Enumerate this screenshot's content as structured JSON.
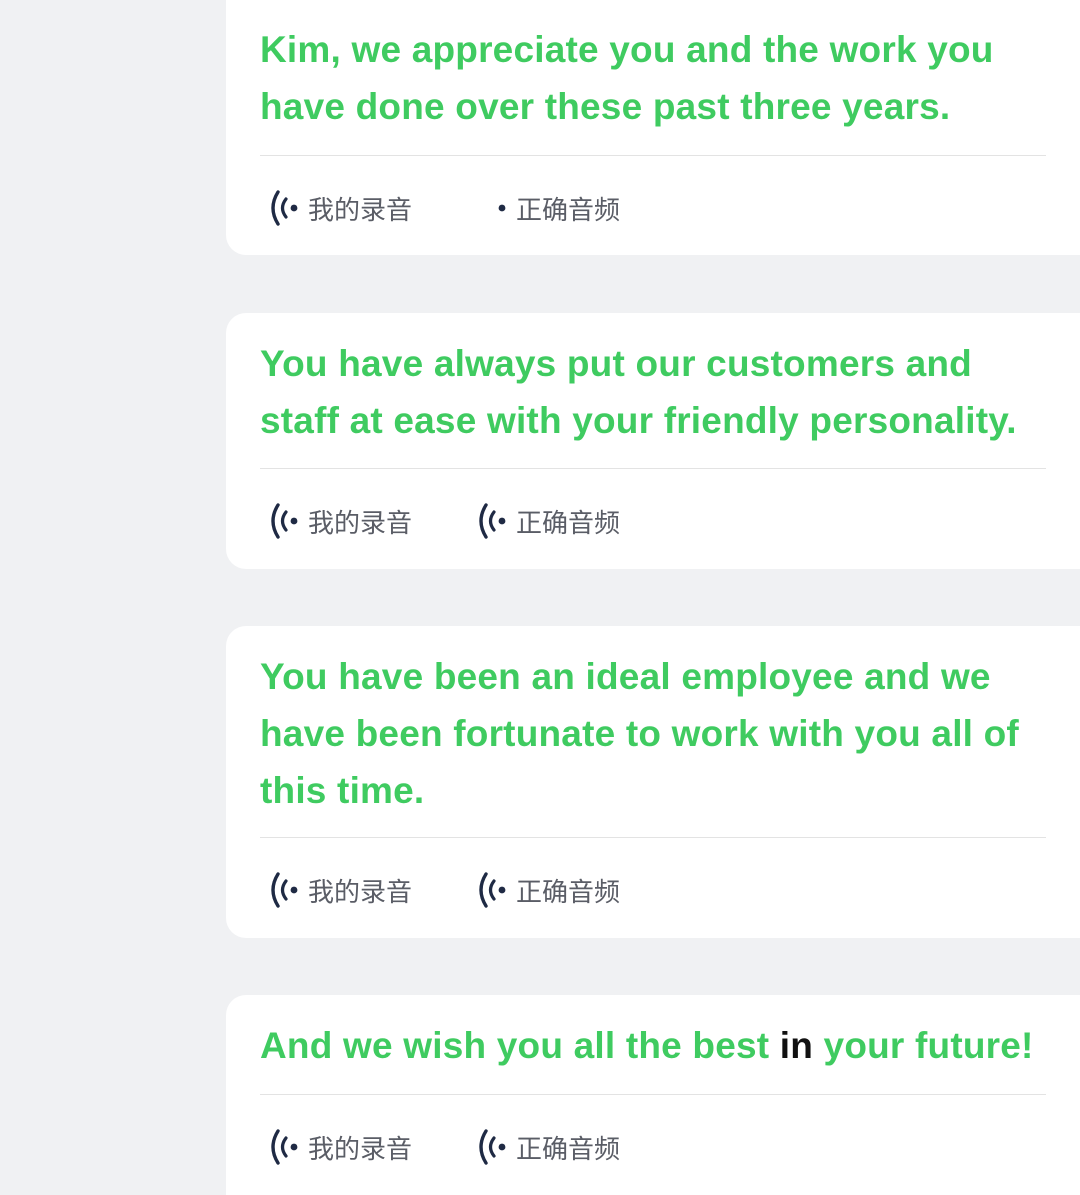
{
  "colors": {
    "correct_text": "#3fcb60",
    "wrong_text": "#111111",
    "label_text": "#5a5d66",
    "icon": "#1f2a44",
    "card_bg": "#ffffff",
    "page_bg": "#f0f1f3"
  },
  "cards": [
    {
      "lines": [
        "Kim, we appreciate you and the work you",
        "have done over these past three years."
      ],
      "my_recording_label": "我的录音",
      "correct_audio_label": "正确音频",
      "correct_audio_icon": "dot-icon"
    },
    {
      "lines": [
        "You have always put our customers and",
        "staff at ease with your friendly personality."
      ],
      "my_recording_label": "我的录音",
      "correct_audio_label": "正确音频",
      "correct_audio_icon": "sound-wave-icon"
    },
    {
      "lines": [
        "You have been an ideal employee and we",
        "have been fortunate to work with you all of",
        "this time."
      ],
      "my_recording_label": "我的录音",
      "correct_audio_label": "正确音频",
      "correct_audio_icon": "sound-wave-icon"
    },
    {
      "segments": [
        {
          "text": "And we wish you all the best ",
          "status": "correct"
        },
        {
          "text": "in",
          "status": "wrong"
        },
        {
          "text": " your future!",
          "status": "correct"
        }
      ],
      "my_recording_label": "我的录音",
      "correct_audio_label": "正确音频",
      "correct_audio_icon": "sound-wave-icon"
    }
  ]
}
